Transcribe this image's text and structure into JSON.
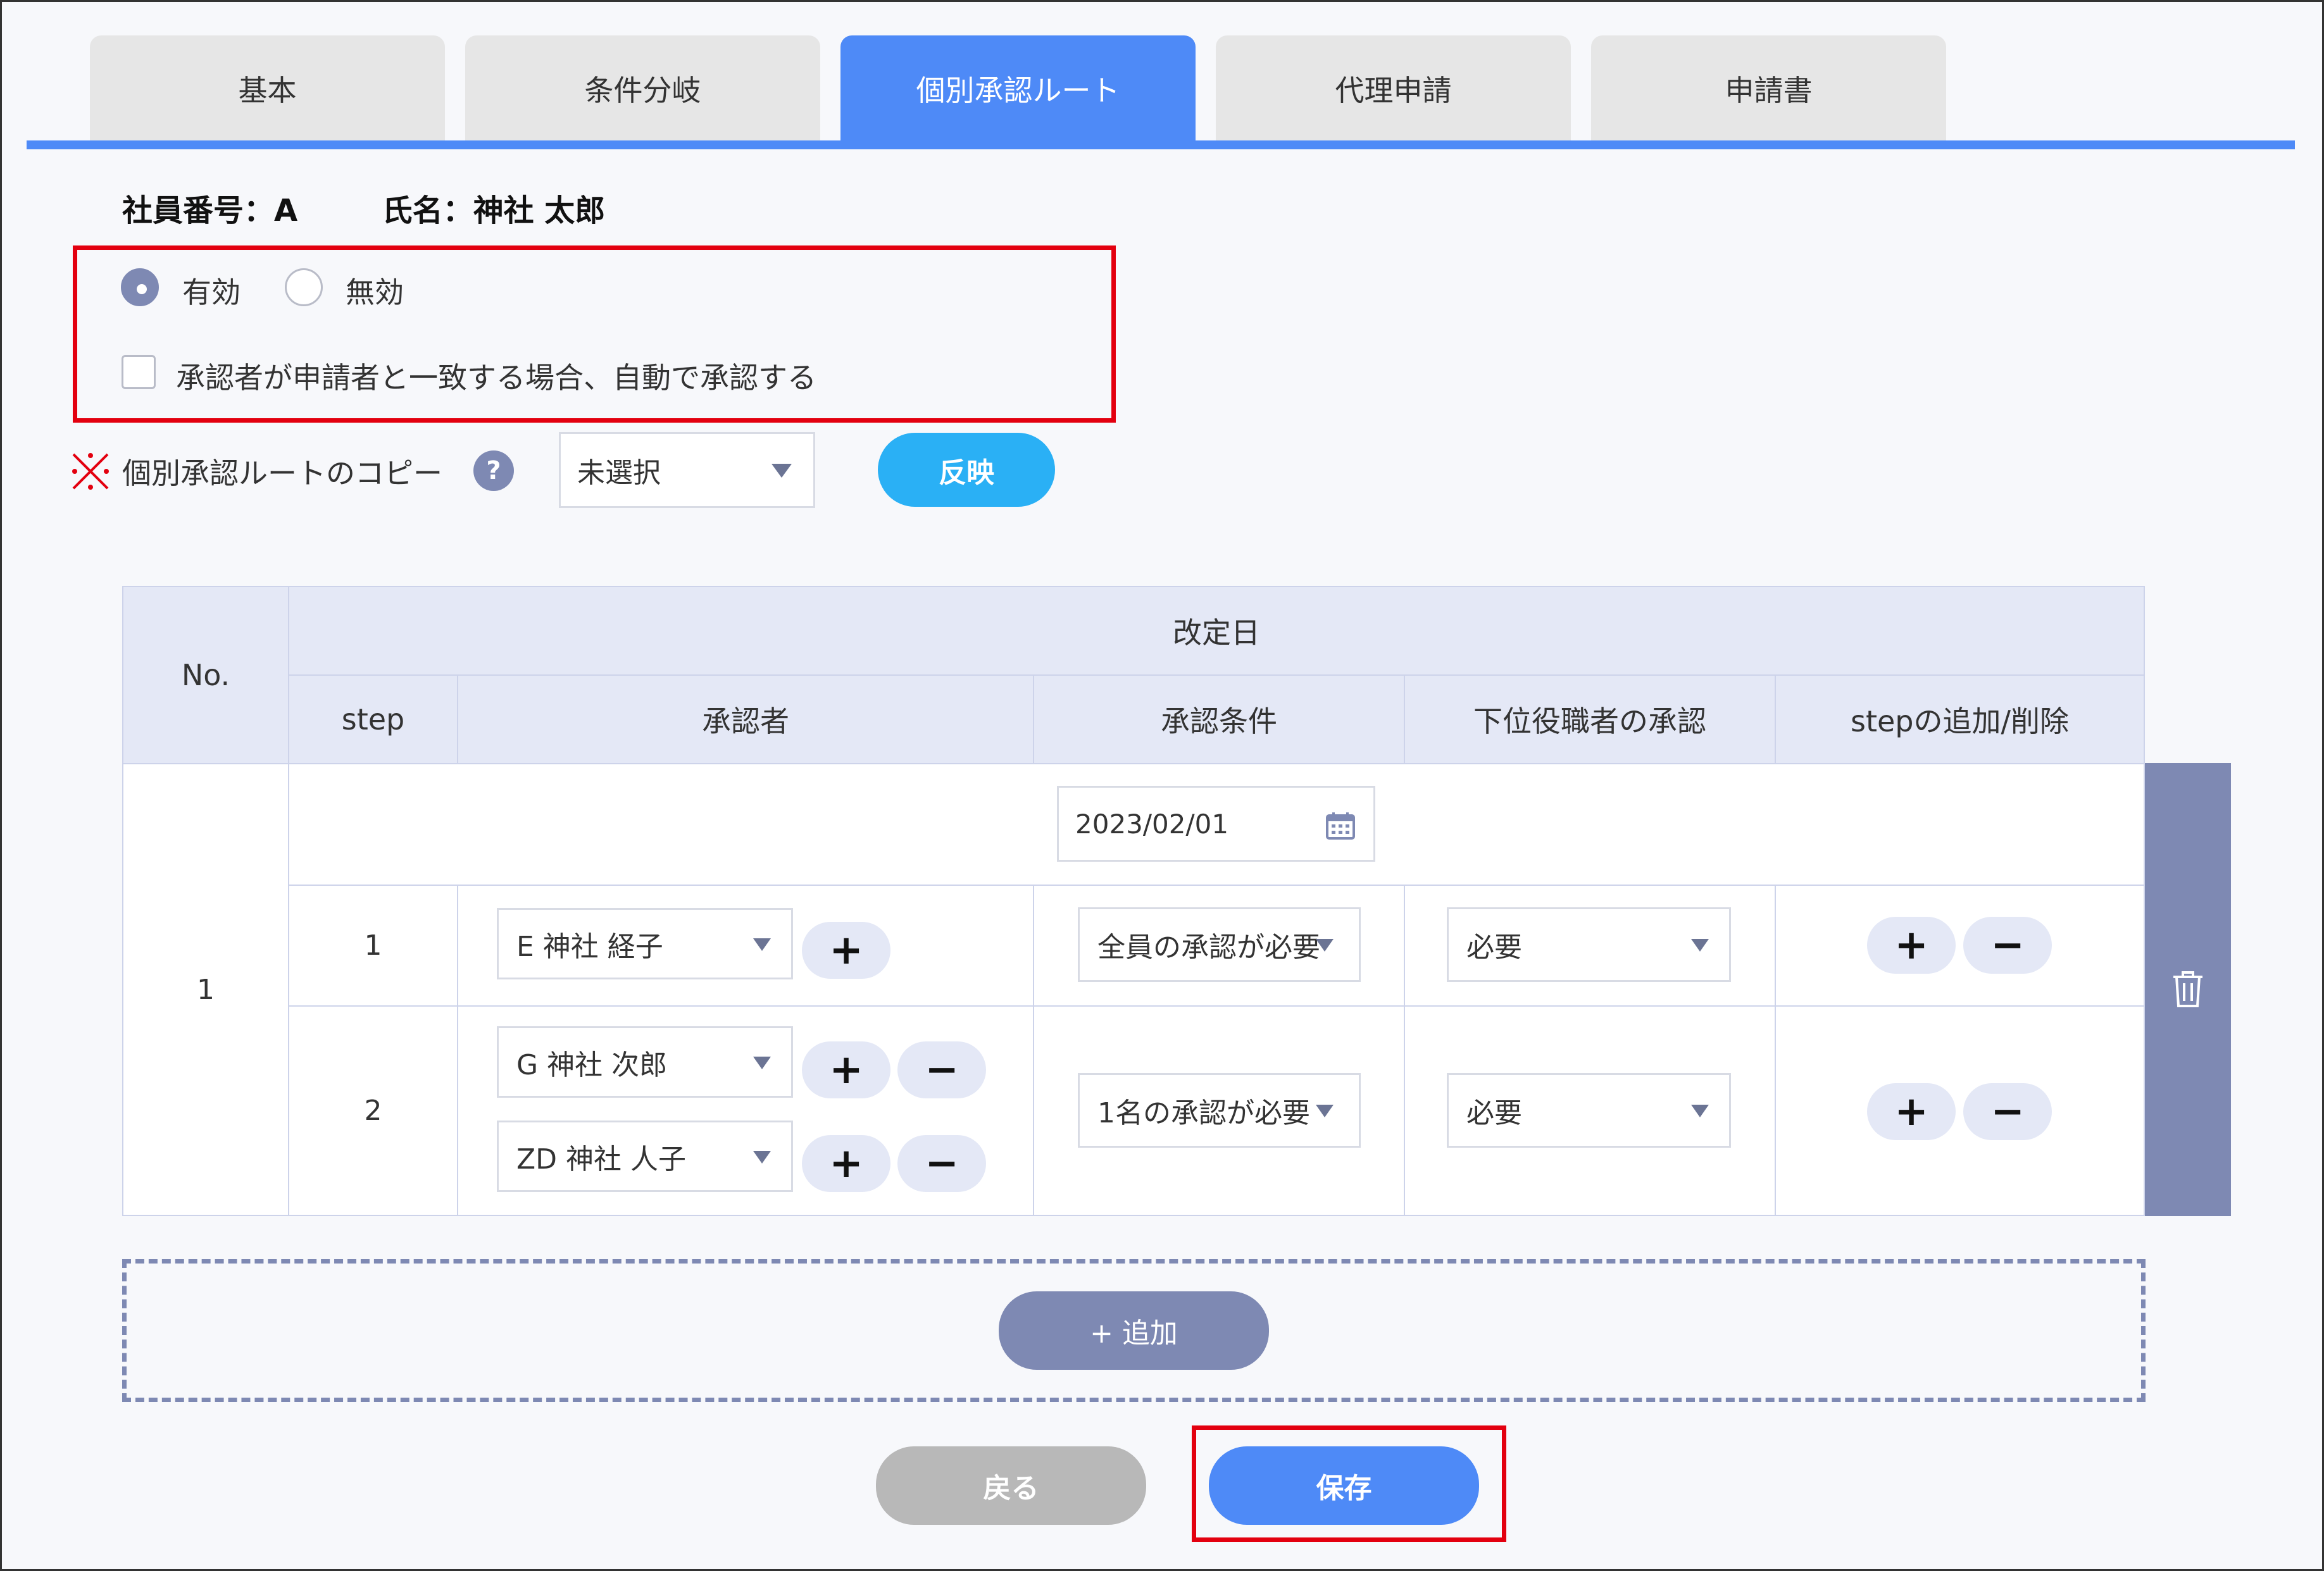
{
  "tabs": [
    {
      "label": "基本"
    },
    {
      "label": "条件分岐"
    },
    {
      "label": "個別承認ルート",
      "active": true
    },
    {
      "label": "代理申請"
    },
    {
      "label": "申請書"
    }
  ],
  "employee": {
    "id_label": "社員番号：A",
    "name_label": "氏名：神社 太郎"
  },
  "status": {
    "enabled_label": "有効",
    "disabled_label": "無効",
    "selected": "有効",
    "auto_approve_label": "承認者が申請者と一致する場合、自動で承認する",
    "auto_approve_checked": false
  },
  "copy": {
    "mark": "※",
    "label": "個別承認ルートのコピー",
    "help": "?",
    "select_value": "未選択",
    "apply_label": "反映"
  },
  "table": {
    "headers": {
      "no": "No.",
      "revision_date": "改定日",
      "step": "step",
      "approver": "承認者",
      "condition": "承認条件",
      "subordinate": "下位役職者の承認",
      "add_remove": "stepの追加/削除"
    },
    "rows": [
      {
        "no": "1",
        "date": "2023/02/01",
        "steps": [
          {
            "step": "1",
            "approvers": [
              "E 神社 経子"
            ],
            "condition": "全員の承認が必要",
            "subordinate": "必要"
          },
          {
            "step": "2",
            "approvers": [
              "G 神社 次郎",
              "ZD 神社 人子"
            ],
            "condition": "1名の承認が必要",
            "subordinate": "必要"
          }
        ]
      }
    ],
    "plus": "+",
    "minus": "−"
  },
  "actions": {
    "add_label": "+  追加",
    "back_label": "戻る",
    "save_label": "保存"
  },
  "colors": {
    "tab_active": "#4e8af7",
    "accent_purple": "#7e89b3",
    "apply_button": "#2ab0f5",
    "save_button": "#4e8af7",
    "back_button": "#b8b8b8",
    "highlight_red": "#e3000f"
  }
}
